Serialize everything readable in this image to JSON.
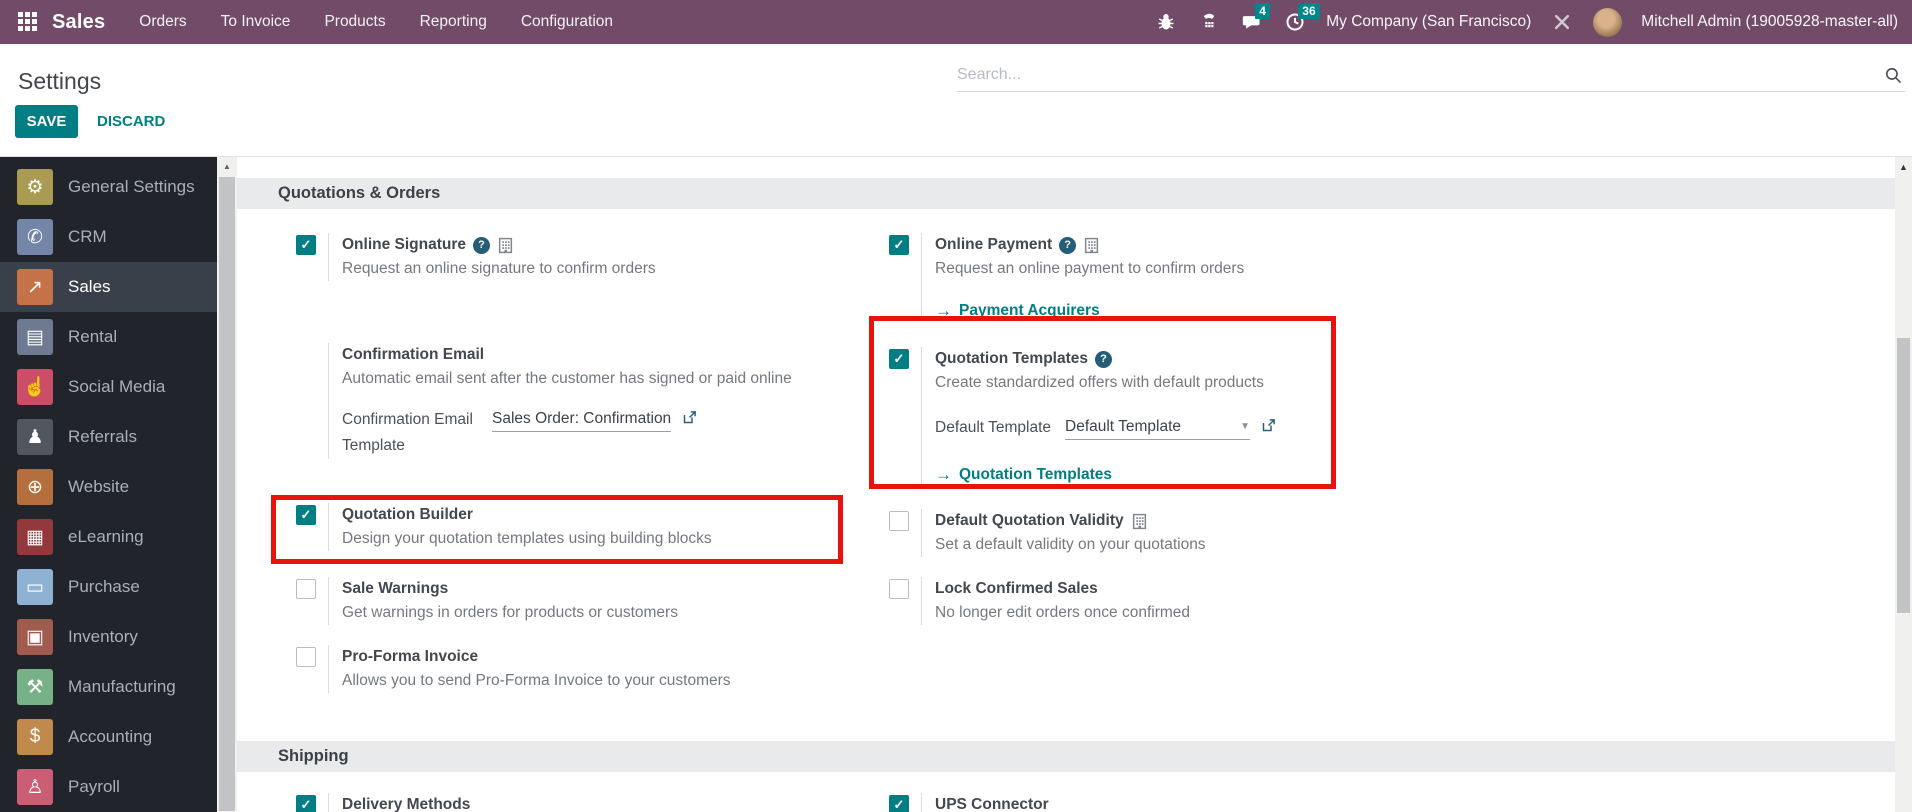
{
  "colors": {
    "accent_teal": "#017E84",
    "navbar_purple": "#714B67",
    "highlight_red": "#E8140C",
    "badge_teal": "#00878A",
    "sidebar_bg": "#21252B"
  },
  "navbar": {
    "brand": "Sales",
    "menu": [
      "Orders",
      "To Invoice",
      "Products",
      "Reporting",
      "Configuration"
    ],
    "badges": {
      "messages": "4",
      "activities": "36"
    },
    "company": "My Company (San Francisco)",
    "user": "Mitchell Admin (19005928-master-all)"
  },
  "control_panel": {
    "title": "Settings",
    "save": "SAVE",
    "discard": "DISCARD",
    "search_placeholder": "Search..."
  },
  "sidebar": {
    "items": [
      {
        "label": "General Settings",
        "icon": "gear-icon",
        "color": "#A99C52",
        "selected": false
      },
      {
        "label": "CRM",
        "icon": "handshake-icon",
        "color": "#7585A8",
        "selected": false
      },
      {
        "label": "Sales",
        "icon": "sales-chart-icon",
        "color": "#C57248",
        "selected": true
      },
      {
        "label": "Rental",
        "icon": "rental-document-icon",
        "color": "#6E7A91",
        "selected": false
      },
      {
        "label": "Social Media",
        "icon": "thumbs-up-icon",
        "color": "#CC4D67",
        "selected": false
      },
      {
        "label": "Referrals",
        "icon": "referral-person-icon",
        "color": "#51565F",
        "selected": false
      },
      {
        "label": "Website",
        "icon": "globe-icon",
        "color": "#B56F3E",
        "selected": false
      },
      {
        "label": "eLearning",
        "icon": "presentation-icon",
        "color": "#93383C",
        "selected": false
      },
      {
        "label": "Purchase",
        "icon": "credit-card-icon",
        "color": "#8FB2D4",
        "selected": false
      },
      {
        "label": "Inventory",
        "icon": "box-icon",
        "color": "#A05B4F",
        "selected": false
      },
      {
        "label": "Manufacturing",
        "icon": "wrench-icon",
        "color": "#77B187",
        "selected": false
      },
      {
        "label": "Accounting",
        "icon": "invoice-icon",
        "color": "#C08A4D",
        "selected": false
      },
      {
        "label": "Payroll",
        "icon": "payroll-icon",
        "color": "#C95E75",
        "selected": false
      }
    ]
  },
  "content": {
    "sections": [
      {
        "title": "Quotations & Orders"
      },
      {
        "title": "Shipping"
      }
    ],
    "settings": {
      "online_signature": {
        "label": "Online Signature",
        "desc": "Request an online signature to confirm orders",
        "checked": true
      },
      "confirmation_email": {
        "label": "Confirmation Email",
        "desc": "Automatic email sent after the customer has signed or paid online"
      },
      "confirmation_email_template": {
        "label": "Confirmation Email Template",
        "value": "Sales Order: Confirmation"
      },
      "quotation_builder": {
        "label": "Quotation Builder",
        "desc": "Design your quotation templates using building blocks",
        "checked": true
      },
      "sale_warnings": {
        "label": "Sale Warnings",
        "desc": "Get warnings in orders for products or customers",
        "checked": false
      },
      "pro_forma": {
        "label": "Pro-Forma Invoice",
        "desc": "Allows you to send Pro-Forma Invoice to your customers",
        "checked": false
      },
      "online_payment": {
        "label": "Online Payment",
        "desc": "Request an online payment to confirm orders",
        "link": "Payment Acquirers",
        "checked": true
      },
      "quotation_templates": {
        "label": "Quotation Templates",
        "desc": "Create standardized offers with default products",
        "field_label": "Default Template",
        "field_value": "Default Template",
        "link": "Quotation Templates",
        "checked": true
      },
      "default_validity": {
        "label": "Default Quotation Validity",
        "desc": "Set a default validity on your quotations",
        "checked": false
      },
      "lock_confirmed": {
        "label": "Lock Confirmed Sales",
        "desc": "No longer edit orders once confirmed",
        "checked": false
      },
      "delivery_methods": {
        "label": "Delivery Methods",
        "checked": true
      },
      "ups_connector": {
        "label": "UPS Connector",
        "checked": true
      }
    }
  }
}
